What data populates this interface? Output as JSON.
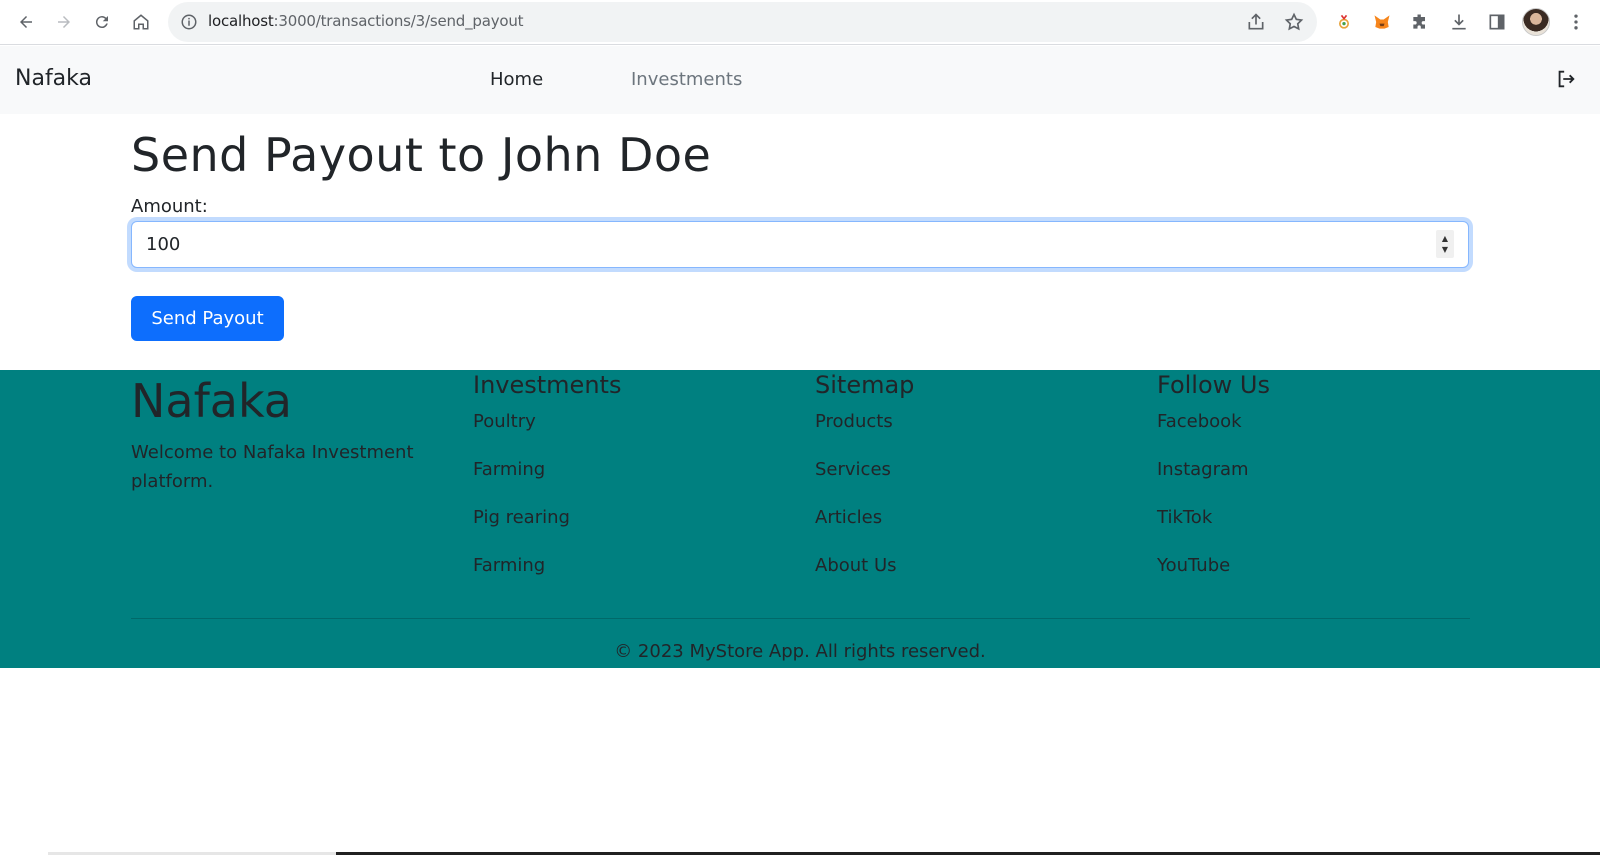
{
  "browser": {
    "url_host": "localhost",
    "url_path": ":3000/transactions/3/send_payout"
  },
  "navbar": {
    "brand": "Nafaka",
    "links": [
      {
        "label": "Home"
      },
      {
        "label": "Investments"
      }
    ]
  },
  "main": {
    "title": "Send Payout to John Doe",
    "amount_label": "Amount:",
    "amount_value": "100",
    "submit_label": "Send Payout"
  },
  "footer": {
    "brand": "Nafaka",
    "welcome": "Welcome to Nafaka Investment platform.",
    "columns": [
      {
        "heading": "Investments",
        "links": [
          "Poultry",
          "Farming",
          "Pig rearing",
          "Farming"
        ]
      },
      {
        "heading": "Sitemap",
        "links": [
          "Products",
          "Services",
          "Articles",
          "About Us"
        ]
      },
      {
        "heading": "Follow Us",
        "links": [
          "Facebook",
          "Instagram",
          "TikTok",
          "YouTube"
        ]
      }
    ],
    "copyright": "© 2023 MyStore App. All rights reserved."
  },
  "colors": {
    "footer_bg": "#008080",
    "primary": "#0d6efd",
    "navbar_bg": "#f8f9fa"
  }
}
